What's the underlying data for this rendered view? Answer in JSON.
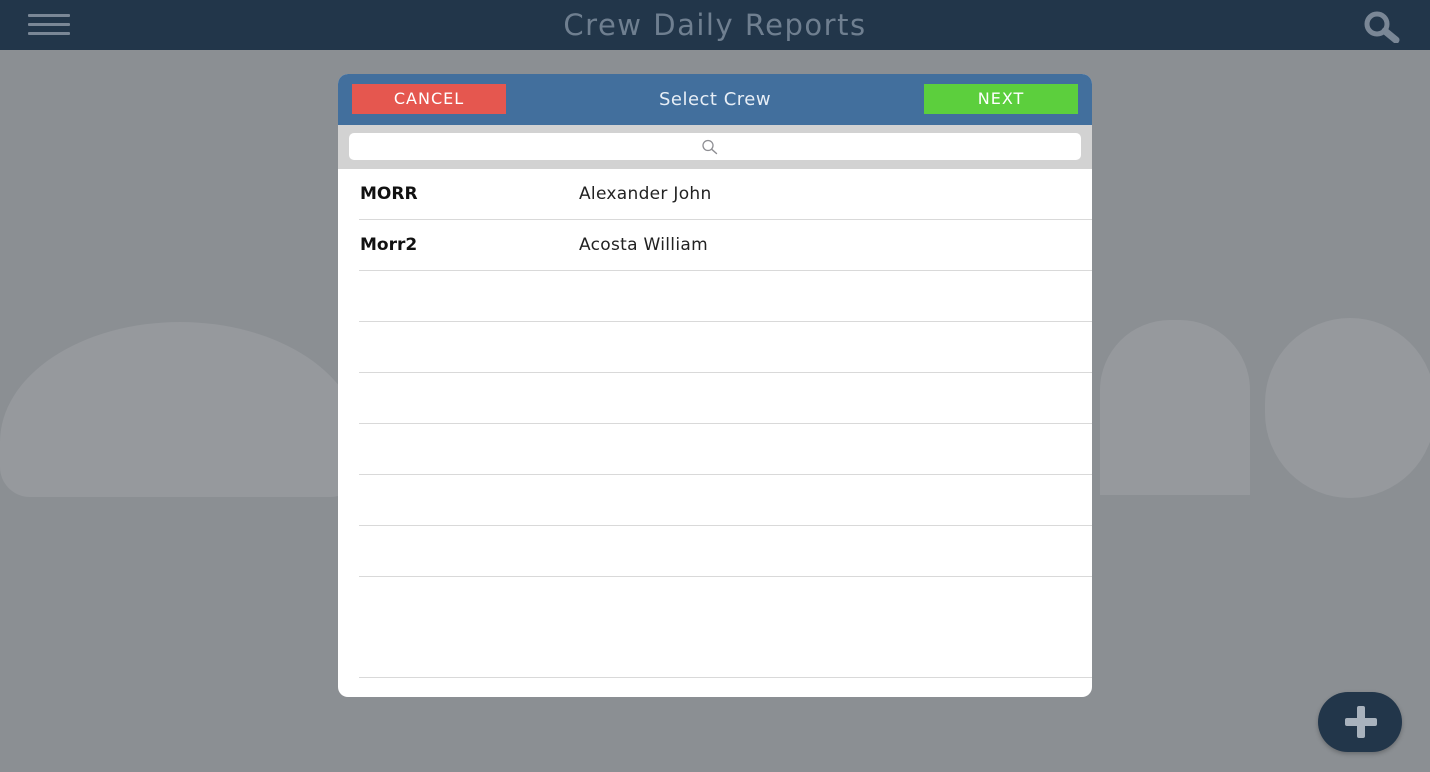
{
  "header": {
    "title": "Crew Daily Reports",
    "menu_icon": "hamburger-menu-icon",
    "search_icon": "search-icon"
  },
  "modal": {
    "title": "Select Crew",
    "cancel_label": "CANCEL",
    "next_label": "NEXT",
    "search": {
      "placeholder": "",
      "value": "",
      "icon": "magnifier-icon"
    },
    "crews": [
      {
        "code": "MORR",
        "name": "Alexander John"
      },
      {
        "code": "Morr2",
        "name": "Acosta William"
      }
    ]
  },
  "fab": {
    "icon": "plus-icon"
  },
  "colors": {
    "nav_bar": "#22364a",
    "modal_header": "#426f9d",
    "cancel": "#e5574f",
    "next": "#5ccf3d",
    "backdrop": "#8b8f93"
  }
}
